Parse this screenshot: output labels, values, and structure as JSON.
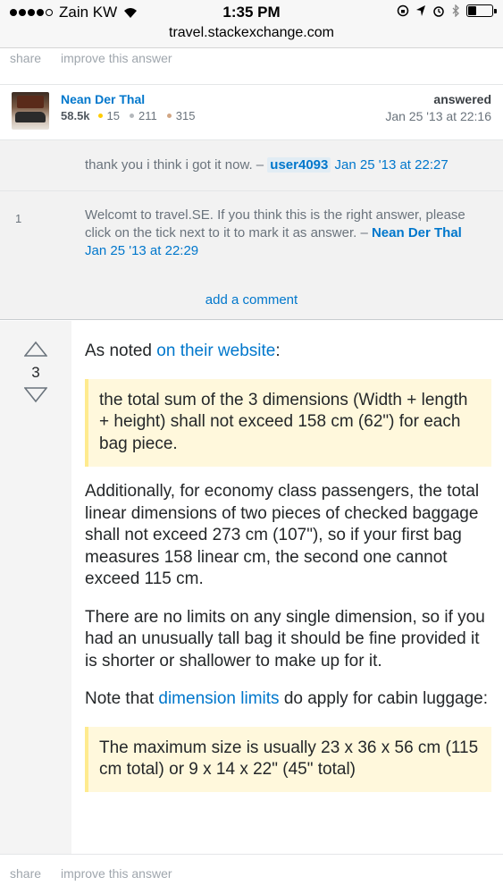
{
  "status_bar": {
    "carrier": "Zain KW",
    "time": "1:35 PM",
    "signal_bars_filled": 4
  },
  "url_bar": {
    "url": "travel.stackexchange.com"
  },
  "top_post_menu": {
    "share_label": "share",
    "improve_label": "improve this answer"
  },
  "answer_user": {
    "name": "Nean Der Thal",
    "reputation": "58.5k",
    "gold_badges": "15",
    "silver_badges": "211",
    "bronze_badges": "315",
    "action_label": "answered",
    "date": "Jan 25 '13 at 22:16"
  },
  "comments": [
    {
      "score": "",
      "text": "thank you i think i got it now. –",
      "user": "user4093",
      "date": "Jan 25 '13 at 22:27"
    },
    {
      "score": "1",
      "text": "Welcomt to travel.SE. If you think this is the right answer, please click on the tick next to it to mark it as answer. –",
      "user": "Nean Der Thal",
      "date": "Jan 25 '13 at 22:29"
    }
  ],
  "add_comment_label": "add a comment",
  "answer": {
    "vote_count": "3",
    "intro_text": "As noted",
    "intro_link": "on their website",
    "intro_suffix": ":",
    "quote1": "the total sum of the 3 dimensions (Width + length + height) shall not exceed 158 cm (62\") for each bag piece.",
    "para1": "Additionally, for economy class passengers, the total linear dimensions of two pieces of checked baggage shall not exceed 273 cm (107\"), so if your first bag measures 158 linear cm, the second one cannot exceed 115 cm.",
    "para2": "There are no limits on any single dimension, so if you had an unusually tall bag it should be fine provided it is shorter or shallower to make up for it.",
    "note_prefix": "Note that",
    "note_link": "dimension limits",
    "note_suffix": "do apply for cabin luggage:",
    "quote2": "The maximum size is usually 23 x 36 x 56 cm (115 cm total) or 9 x 14 x 22\" (45\" total)"
  },
  "bottom_post_menu": {
    "share_label": "share",
    "improve_label": "improve this answer"
  },
  "colors": {
    "link": "#0077cc",
    "muted": "#9fa6ad",
    "quote_bg": "#fff8dc",
    "quote_border": "#ffeb8e",
    "comment_bg": "#f2f2f2",
    "gold": "#ffcc01",
    "silver": "#b4b8bc",
    "bronze": "#d1a684"
  }
}
